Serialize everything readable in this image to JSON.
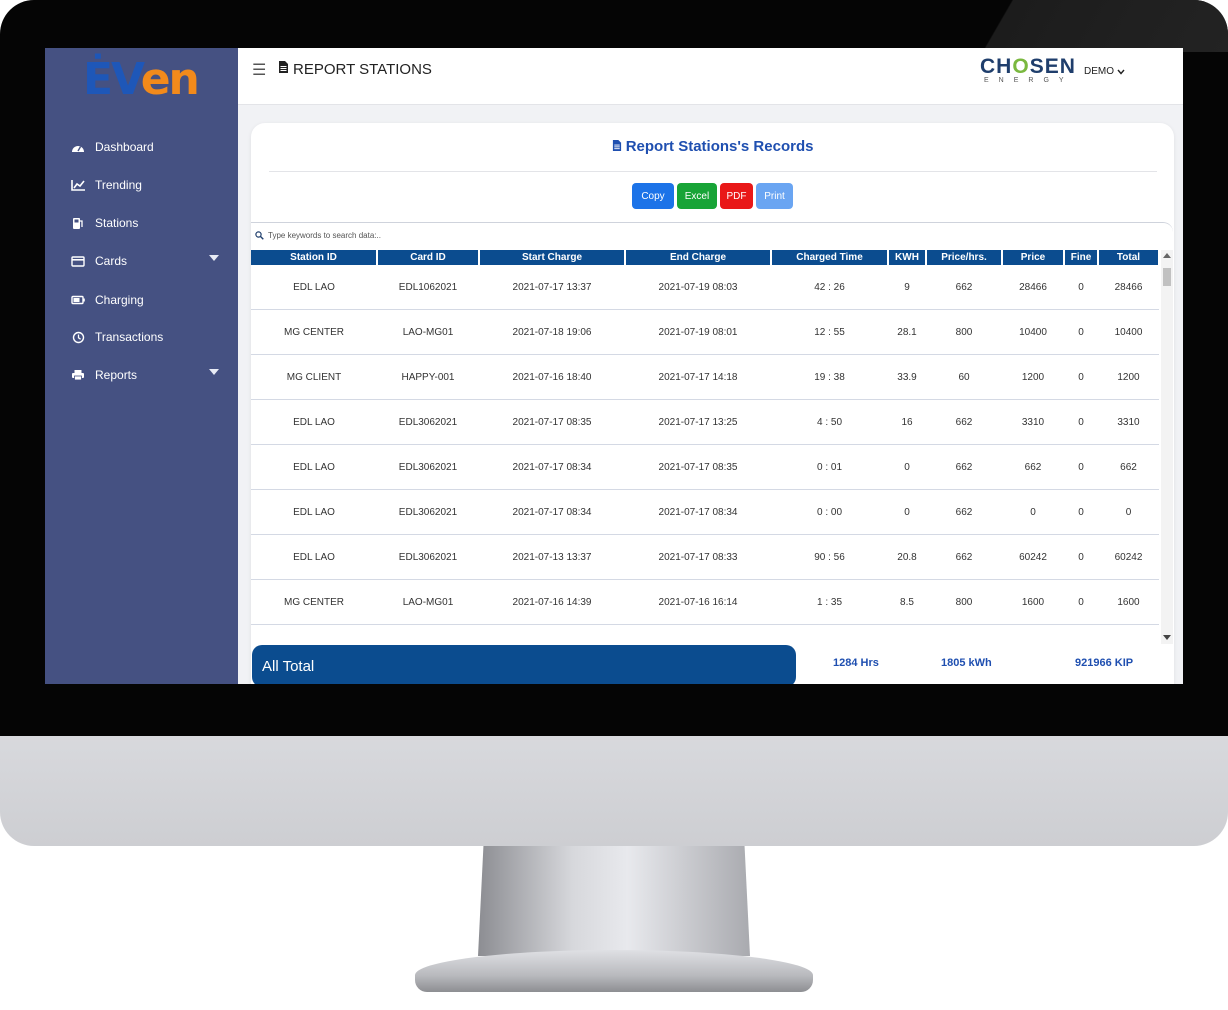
{
  "app": {
    "logo_part1": "ĖV",
    "logo_part2": "en",
    "page_title": "REPORT STATIONS",
    "brand_name_a": "CH",
    "brand_name_o": "O",
    "brand_name_b": "SEN",
    "brand_sub": "ENERGY",
    "user": "DEMO"
  },
  "sidebar": {
    "items": [
      {
        "label": "Dashboard",
        "icon": "dashboard-icon"
      },
      {
        "label": "Trending",
        "icon": "chart-icon"
      },
      {
        "label": "Stations",
        "icon": "station-icon"
      },
      {
        "label": "Cards",
        "icon": "card-icon"
      },
      {
        "label": "Charging",
        "icon": "battery-icon"
      },
      {
        "label": "Transactions",
        "icon": "history-icon"
      },
      {
        "label": "Reports",
        "icon": "printer-icon"
      }
    ]
  },
  "report": {
    "title": "Report Stations's Records",
    "buttons": {
      "copy": "Copy",
      "excel": "Excel",
      "pdf": "PDF",
      "print": "Print"
    },
    "search_placeholder": "Type keywords to search data:..",
    "columns": [
      "Station ID",
      "Card ID",
      "Start Charge",
      "End Charge",
      "Charged Time",
      "KWH",
      "Price/hrs.",
      "Price",
      "Fine",
      "Total"
    ],
    "rows": [
      [
        "EDL LAO",
        "EDL1062021",
        "2021-07-17 13:37",
        "2021-07-19 08:03",
        "42 : 26",
        "9",
        "662",
        "28466",
        "0",
        "28466"
      ],
      [
        "MG CENTER",
        "LAO-MG01",
        "2021-07-18 19:06",
        "2021-07-19 08:01",
        "12 : 55",
        "28.1",
        "800",
        "10400",
        "0",
        "10400"
      ],
      [
        "MG CLIENT",
        "HAPPY-001",
        "2021-07-16 18:40",
        "2021-07-17 14:18",
        "19 : 38",
        "33.9",
        "60",
        "1200",
        "0",
        "1200"
      ],
      [
        "EDL LAO",
        "EDL3062021",
        "2021-07-17 08:35",
        "2021-07-17 13:25",
        "4 : 50",
        "16",
        "662",
        "3310",
        "0",
        "3310"
      ],
      [
        "EDL LAO",
        "EDL3062021",
        "2021-07-17 08:34",
        "2021-07-17 08:35",
        "0 : 01",
        "0",
        "662",
        "662",
        "0",
        "662"
      ],
      [
        "EDL LAO",
        "EDL3062021",
        "2021-07-17 08:34",
        "2021-07-17 08:34",
        "0 : 00",
        "0",
        "662",
        "0",
        "0",
        "0"
      ],
      [
        "EDL LAO",
        "EDL3062021",
        "2021-07-13 13:37",
        "2021-07-17 08:33",
        "90 : 56",
        "20.8",
        "662",
        "60242",
        "0",
        "60242"
      ],
      [
        "MG CENTER",
        "LAO-MG01",
        "2021-07-16 14:39",
        "2021-07-16 16:14",
        "1 : 35",
        "8.5",
        "800",
        "1600",
        "0",
        "1600"
      ]
    ],
    "totals": {
      "label": "All Total",
      "hours": "1284 Hrs",
      "kwh": "1805 kWh",
      "amount": "921966 KIP"
    }
  },
  "colors": {
    "sidebar": "#455182",
    "header_row": "#0b4c8f",
    "title_blue": "#1f4fb0",
    "copy": "#1c73e8",
    "excel": "#18a437",
    "pdf": "#e91818",
    "print": "#6aa5f2"
  }
}
